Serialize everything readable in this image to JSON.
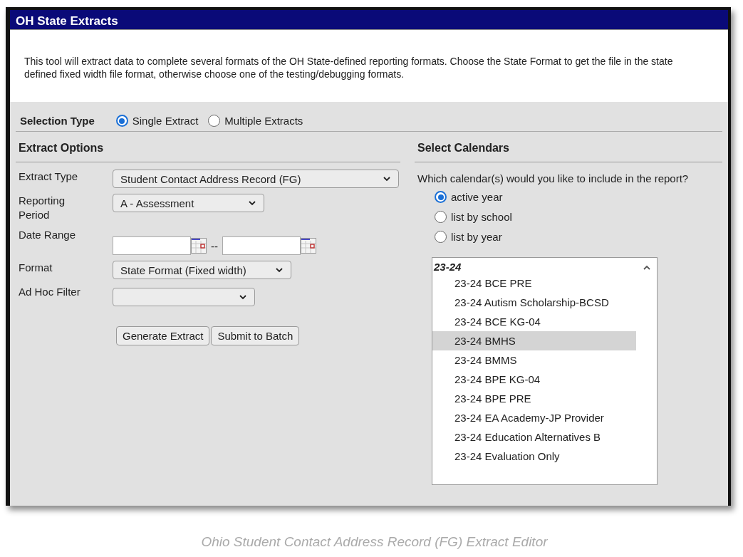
{
  "window": {
    "title": "OH State Extracts"
  },
  "description": "This tool will extract data to complete several formats of the OH State-defined reporting formats. Choose the State Format to get the file in the state defined fixed width file format, otherwise choose one of the testing/debugging formats.",
  "selection_type": {
    "label": "Selection Type",
    "options": [
      {
        "label": "Single Extract",
        "selected": true
      },
      {
        "label": "Multiple Extracts",
        "selected": false
      }
    ]
  },
  "extract_options": {
    "heading": "Extract Options",
    "fields": [
      {
        "kind": "select",
        "label": "Extract Type",
        "value": "Student Contact Address Record (FG)"
      },
      {
        "kind": "select",
        "label": "Reporting Period",
        "value": "A - Assessment"
      },
      {
        "kind": "date_range",
        "label": "Date Range",
        "separator": "--"
      },
      {
        "kind": "select",
        "label": "Format",
        "value": "State Format (Fixed width)"
      },
      {
        "kind": "select",
        "label": "Ad Hoc Filter"
      }
    ],
    "buttons": [
      "Generate Extract",
      "Submit to Batch"
    ]
  },
  "calendars": {
    "heading": "Select Calendars",
    "question": "Which calendar(s) would you like to include in the report?",
    "options": [
      {
        "label": "active year",
        "selected": true
      },
      {
        "label": "list by school",
        "selected": false
      },
      {
        "label": "list by year",
        "selected": false
      }
    ],
    "list": {
      "group": "23-24",
      "items": [
        {
          "label": "23-24 BCE PRE",
          "selected": false
        },
        {
          "label": "23-24 Autism Scholarship-BCSD",
          "selected": false
        },
        {
          "label": "23-24 BCE KG-04",
          "selected": false
        },
        {
          "label": "23-24 BMHS",
          "selected": true
        },
        {
          "label": "23-24 BMMS",
          "selected": false
        },
        {
          "label": "23-24 BPE KG-04",
          "selected": false
        },
        {
          "label": "23-24 BPE PRE",
          "selected": false
        },
        {
          "label": "23-24 EA Academy-JP Provider",
          "selected": false
        },
        {
          "label": "23-24 Education Alternatives B",
          "selected": false
        },
        {
          "label": "23-24 Evaluation Only",
          "selected": false
        }
      ]
    }
  },
  "caption": "Ohio Student Contact Address Record (FG) Extract Editor"
}
